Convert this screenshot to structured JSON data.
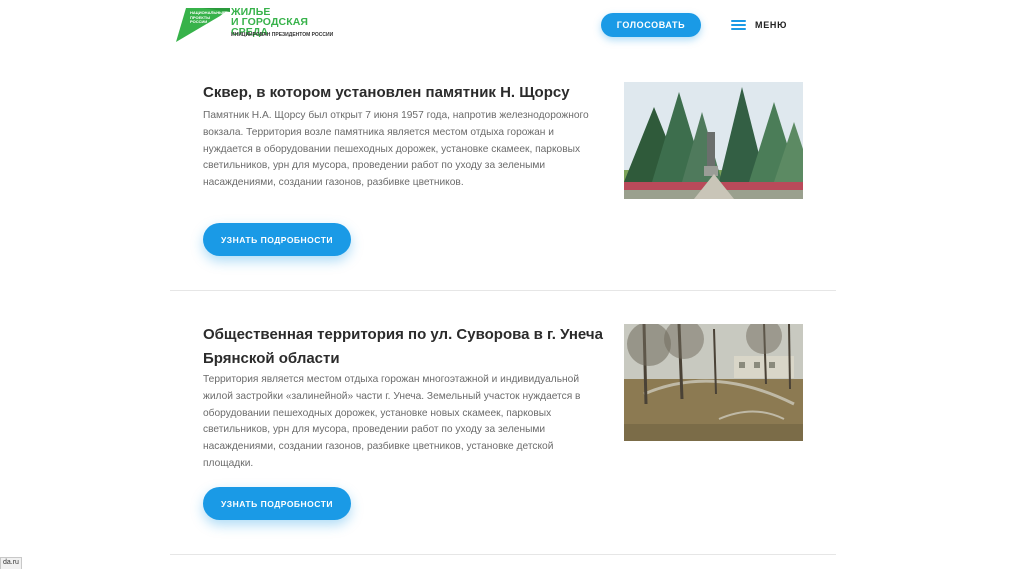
{
  "header": {
    "logo_small": "НАЦИОНАЛЬНЫЕ ПРОЕКТЫ РОССИИ",
    "logo_title": "ЖИЛЬЕ\nИ ГОРОДСКАЯ СРЕДА",
    "logo_sub": "ИНИЦИИРОВАН ПРЕЗИДЕНТОМ РОССИИ",
    "vote_label": "ГОЛОСОВАТЬ",
    "menu_label": "МЕНЮ"
  },
  "items": [
    {
      "title": "Сквер, в котором установлен памятник Н. Щорсу",
      "description": "Памятник Н.А. Щорсу был открыт 7 июня 1957 года, напротив железнодорожного вокзала. Территория возле памятника является местом отдыха горожан и нуждается в оборудовании пешеходных дорожек, установке скамеек, парковых светильников, урн для мусора, проведении работ по уходу за зелеными насаждениями, создании газонов, разбивке цветников.",
      "button_label": "УЗНАТЬ ПОДРОБНОСТИ"
    },
    {
      "title": "Общественная территория по ул. Суворова в г. Унеча Брянской области",
      "description": "Территория является местом отдыха горожан многоэтажной и индивидуальной жилой застройки «залинейной» части г. Унеча. Земельный участок нуждается в оборудовании пешеходных дорожек, установке новых скамеек, парковых светильников, урн для мусора, проведении работ по уходу за зелеными насаждениями, создании газонов, разбивке цветников, установке детской площадки.",
      "button_label": "УЗНАТЬ ПОДРОБНОСТИ"
    }
  ],
  "status_bar": {
    "text": "da.ru"
  },
  "colors": {
    "accent": "#1a9ae6",
    "brand_green": "#37b24a"
  }
}
